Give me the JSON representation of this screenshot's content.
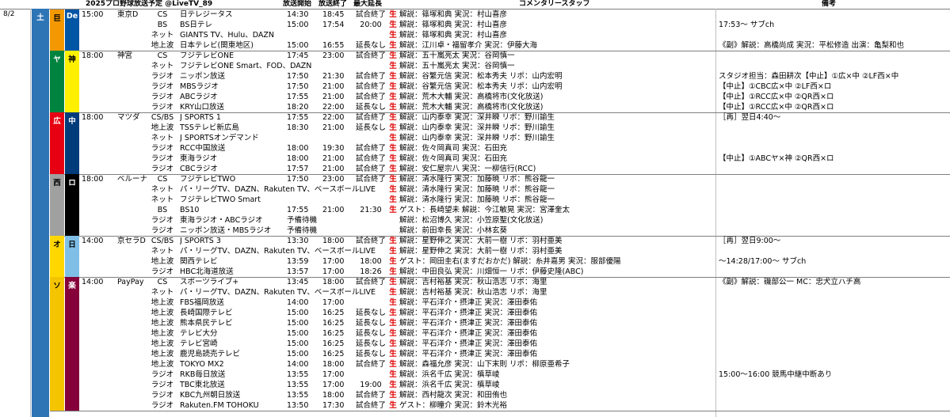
{
  "header": {
    "title": "2025プロ野球放送予定 @LiveTV_89",
    "start": "放送開始",
    "end": "放送終了",
    "max_ext": "最大延長",
    "commentary": "コメンタリースタッフ",
    "notes": "備考"
  },
  "date": "8/2",
  "day_of_week": "土",
  "games": [
    {
      "home": "巨",
      "away": "De",
      "home_bg": "#f39800",
      "home_fg": "#000000",
      "away_bg": "#0055a5",
      "away_fg": "#ffffff",
      "time": "15:00",
      "venue": "東京D",
      "rows": [
        {
          "type": "CS",
          "station": "日テレジータス",
          "start": "14:30",
          "end": "18:45",
          "ext": "試合終了",
          "live": "生",
          "staff": "解説：篠塚和典 実況：村山喜彦",
          "note": ""
        },
        {
          "type": "BS",
          "station": "BS日テレ",
          "start": "15:00",
          "end": "17:54",
          "ext": "20:00",
          "live": "生",
          "staff": "解説：篠塚和典 実況：村山喜彦",
          "note": "17:53～ サブch"
        },
        {
          "type": "ネット",
          "station": "GIANTS TV、Hulu、DAZN",
          "start": "",
          "end": "",
          "ext": "",
          "live": "生",
          "staff": "解説：篠塚和典 実況：村山喜彦",
          "note": ""
        },
        {
          "type": "地上波",
          "station": "日本テレビ(関東地区)",
          "start": "15:00",
          "end": "16:55",
          "ext": "延長なし",
          "live": "生",
          "staff": "解説：江川卓・福留孝介 実況：伊藤大海",
          "note": "《副》解説：高橋尚成 実況：平松修造 出演：亀梨和也"
        }
      ]
    },
    {
      "home": "ヤ",
      "away": "神",
      "home_bg": "#00833f",
      "home_fg": "#ffffff",
      "away_bg": "#fff000",
      "away_fg": "#000000",
      "time": "18:00",
      "venue": "神宮",
      "rows": [
        {
          "type": "CS",
          "station": "フジテレビONE",
          "start": "17:45",
          "end": "23:00",
          "ext": "試合終了",
          "live": "生",
          "staff": "解説：五十嵐亮太 実況：谷岡慎一",
          "note": ""
        },
        {
          "type": "ネット",
          "station": "フジテレビONE Smart、FOD、DAZN",
          "start": "",
          "end": "",
          "ext": "",
          "live": "生",
          "staff": "解説：五十嵐亮太 実況：谷岡慎一",
          "note": ""
        },
        {
          "type": "ラジオ",
          "station": "ニッポン放送",
          "start": "17:50",
          "end": "21:30",
          "ext": "試合終了",
          "live": "生",
          "staff": "解説：谷繁元信 実況：松本秀夫 リポ：山内宏明",
          "note": "スタジオ担当：森田耕次【中止】①広×中 ②LF西×中"
        },
        {
          "type": "ラジオ",
          "station": "MBSラジオ",
          "start": "17:50",
          "end": "21:00",
          "ext": "試合終了",
          "live": "生",
          "staff": "解説：谷繁元信 実況：松本秀夫 リポ：山内宏明",
          "note": "【中止】①CBC広×中 ②LF西×ロ"
        },
        {
          "type": "ラジオ",
          "station": "ABCラジオ",
          "start": "17:55",
          "end": "21:00",
          "ext": "試合終了",
          "live": "生",
          "staff": "解説：荒木大輔 実況：高橋将市(文化放送)",
          "note": "【中止】①RCC広×中 ②QR西×ロ"
        },
        {
          "type": "ラジオ",
          "station": "KRY山口放送",
          "start": "18:20",
          "end": "22:00",
          "ext": "延長なし",
          "live": "生",
          "staff": "解説：荒木大輔 実況：高橋将市(文化放送)",
          "note": "【中止】①RCC広×中 ②QR西×ロ"
        }
      ]
    },
    {
      "home": "広",
      "away": "中",
      "home_bg": "#e60012",
      "home_fg": "#ffffff",
      "away_bg": "#003b7a",
      "away_fg": "#ffffff",
      "time": "18:00",
      "venue": "マツダ",
      "rows": [
        {
          "type": "CS/BS",
          "station": "J SPORTS 1",
          "start": "17:55",
          "end": "22:00",
          "ext": "試合終了",
          "live": "生",
          "staff": "解説：山内泰幸 実況：深井瞬 リポ：野川諭生",
          "note": "［再］翌日4:40～"
        },
        {
          "type": "地上波",
          "station": "TSSテレビ新広島",
          "start": "18:30",
          "end": "21:00",
          "ext": "延長なし",
          "live": "生",
          "staff": "解説：山内泰幸 実況：深井瞬 リポ：野川諭生",
          "note": ""
        },
        {
          "type": "ネット",
          "station": "J SPORTSオンデマンド",
          "start": "",
          "end": "",
          "ext": "",
          "live": "生",
          "staff": "解説：山内泰幸 実況：深井瞬 リポ：野川諭生",
          "note": ""
        },
        {
          "type": "ラジオ",
          "station": "RCC中国放送",
          "start": "18:00",
          "end": "19:30",
          "ext": "試合終了",
          "live": "生",
          "staff": "解説：佐々岡真司 実況：石田充",
          "note": ""
        },
        {
          "type": "ラジオ",
          "station": "東海ラジオ",
          "start": "18:00",
          "end": "21:00",
          "ext": "試合終了",
          "live": "生",
          "staff": "解説：佐々岡真司 実況：石田充",
          "note": "【中止】①ABCヤ×神 ②QR西×ロ"
        },
        {
          "type": "ラジオ",
          "station": "CBCラジオ",
          "start": "17:57",
          "end": "21:00",
          "ext": "試合終了",
          "live": "生",
          "staff": "解説：安仁屋宗八 実況：一柳信行(RCC)",
          "note": ""
        }
      ]
    },
    {
      "home": "西",
      "away": "ロ",
      "home_bg": "#a0a0a0",
      "home_fg": "#000000",
      "away_bg": "#000000",
      "away_fg": "#ffffff",
      "time": "18:00",
      "venue": "ベルーナ",
      "rows": [
        {
          "type": "CS",
          "station": "フジテレビTWO",
          "start": "17:50",
          "end": "23:00",
          "ext": "試合終了",
          "live": "生",
          "staff": "解説：清水隆行 実況：加藤暁 リポ：熊谷龍一",
          "note": ""
        },
        {
          "type": "ネット",
          "station": "パ・リーグTV、DAZN、Rakuten TV、ベースボールLIVE",
          "start": "",
          "end": "",
          "ext": "",
          "live": "生",
          "staff": "解説：清水隆行 実況：加藤暁 リポ：熊谷龍一",
          "note": ""
        },
        {
          "type": "ネット",
          "station": "フジテレビTWO Smart",
          "start": "",
          "end": "",
          "ext": "",
          "live": "生",
          "staff": "解説：清水隆行 実況：加藤暁 リポ：熊谷龍一",
          "note": ""
        },
        {
          "type": "BS",
          "station": "BS10",
          "start": "17:55",
          "end": "21:00",
          "ext": "21:30",
          "live": "生",
          "staff": "ゲスト：長崎望未 解説：今江敏晃 実況：宮澤奎太",
          "note": ""
        },
        {
          "type": "ラジオ",
          "station": "東海ラジオ・ABCラジオ",
          "start": "予備待機",
          "end": "",
          "ext": "",
          "live": "",
          "staff": "解説：松沼博久 実況：小笠原聖(文化放送)",
          "note": ""
        },
        {
          "type": "ラジオ",
          "station": "ニッポン放送・MBSラジオ",
          "start": "予備待機",
          "end": "",
          "ext": "",
          "live": "",
          "staff": "解説：前田幸長 実況：小林玄葵",
          "note": ""
        }
      ]
    },
    {
      "home": "オ",
      "away": "日",
      "home_bg": "#ffd700",
      "home_fg": "#000000",
      "away_bg": "#7fbfe6",
      "away_fg": "#000000",
      "time": "14:00",
      "venue": "京セラD",
      "rows": [
        {
          "type": "CS/BS",
          "station": "J SPORTS 3",
          "start": "13:30",
          "end": "18:00",
          "ext": "試合終了",
          "live": "生",
          "staff": "解説：星野伸之 実況：大前一樹 リポ：羽村亜美",
          "note": "［再］翌日9:00～"
        },
        {
          "type": "ネット",
          "station": "パ・リーグTV、DAZN、Rakuten TV、ベースボールLIVE",
          "start": "",
          "end": "",
          "ext": "",
          "live": "生",
          "staff": "解説：星野伸之 実況：大前一樹 リポ：羽村亜美",
          "note": ""
        },
        {
          "type": "地上波",
          "station": "関西テレビ",
          "start": "13:59",
          "end": "17:00",
          "ext": "18:00",
          "live": "生",
          "staff": "ゲスト：岡田圭右(ますだおかだ) 解説：糸井嘉男 実況：服部優陽",
          "note": "～14:28/17:00～ サブch"
        },
        {
          "type": "ラジオ",
          "station": "HBC北海道放送",
          "start": "13:57",
          "end": "17:00",
          "ext": "18:26",
          "live": "生",
          "staff": "解説：中田良弘 実況：川畑恒一 リポ：伊藤史隆(ABC)",
          "note": ""
        }
      ]
    },
    {
      "home": "ソ",
      "away": "楽",
      "home_bg": "#f5c400",
      "home_fg": "#000000",
      "away_bg": "#85003a",
      "away_fg": "#ffffff",
      "time": "14:00",
      "venue": "PayPay",
      "rows": [
        {
          "type": "CS",
          "station": "スポーツライブ+",
          "start": "13:45",
          "end": "18:00",
          "ext": "試合終了",
          "live": "生",
          "staff": "解説：吉村裕基 実況：秋山浩志 リポ：海里",
          "note": "《副》解説：磯部公一 MC：忠犬立ハチ高"
        },
        {
          "type": "ネット",
          "station": "パ・リーグTV、DAZN、Rakuten TV、ベースボールLIVE",
          "start": "",
          "end": "",
          "ext": "",
          "live": "生",
          "staff": "解説：吉村裕基 実況：秋山浩志 リポ：海里",
          "note": ""
        },
        {
          "type": "地上波",
          "station": "FBS福岡放送",
          "start": "14:00",
          "end": "17:00",
          "ext": "",
          "live": "生",
          "staff": "解説：平石洋介・摂津正 実況：澤田泰佑",
          "note": ""
        },
        {
          "type": "地上波",
          "station": "長崎国際テレビ",
          "start": "15:00",
          "end": "16:25",
          "ext": "延長なし",
          "live": "生",
          "staff": "解説：平石洋介・摂津正 実況：澤田泰佑",
          "note": ""
        },
        {
          "type": "地上波",
          "station": "熊本県民テレビ",
          "start": "15:00",
          "end": "16:25",
          "ext": "延長なし",
          "live": "生",
          "staff": "解説：平石洋介・摂津正 実況：澤田泰佑",
          "note": ""
        },
        {
          "type": "地上波",
          "station": "テレビ大分",
          "start": "15:00",
          "end": "16:25",
          "ext": "延長なし",
          "live": "生",
          "staff": "解説：平石洋介・摂津正 実況：澤田泰佑",
          "note": ""
        },
        {
          "type": "地上波",
          "station": "テレビ宮崎",
          "start": "15:00",
          "end": "16:25",
          "ext": "延長なし",
          "live": "生",
          "staff": "解説：平石洋介・摂津正 実況：澤田泰佑",
          "note": ""
        },
        {
          "type": "地上波",
          "station": "鹿児島読売テレビ",
          "start": "15:00",
          "end": "16:25",
          "ext": "延長なし",
          "live": "生",
          "staff": "解説：平石洋介・摂津正 実況：澤田泰佑",
          "note": ""
        },
        {
          "type": "地上波",
          "station": "TOKYO MX2",
          "start": "14:00",
          "end": "18:00",
          "ext": "試合終了",
          "live": "生",
          "staff": "解説：森福允彦 実況：山下末則 リポ：柳原亜希子",
          "note": ""
        },
        {
          "type": "ラジオ",
          "station": "RKB毎日放送",
          "start": "13:55",
          "end": "17:00",
          "ext": "",
          "live": "生",
          "staff": "解説：浜名千広 実況：槙草崚",
          "note": "15:00～16:00 競馬中継中断あり"
        },
        {
          "type": "ラジオ",
          "station": "TBC東北放送",
          "start": "13:55",
          "end": "17:00",
          "ext": "19:00",
          "live": "生",
          "staff": "解説：浜名千広 実況：槙草崚",
          "note": ""
        },
        {
          "type": "ラジオ",
          "station": "KBC九州朝日放送",
          "start": "13:55",
          "end": "18:00",
          "ext": "試合終了",
          "live": "生",
          "staff": "解説：西村龍次 実況：和田侑也",
          "note": ""
        },
        {
          "type": "ラジオ",
          "station": "Rakuten.FM TOHOKU",
          "start": "13:50",
          "end": "17:30",
          "ext": "試合終了",
          "live": "生",
          "staff": "ゲスト：柳瞳介 実況：鈴木光裕",
          "note": ""
        }
      ]
    }
  ],
  "colors": {
    "live": "#e00000",
    "day_bg": "#2e75b6"
  }
}
